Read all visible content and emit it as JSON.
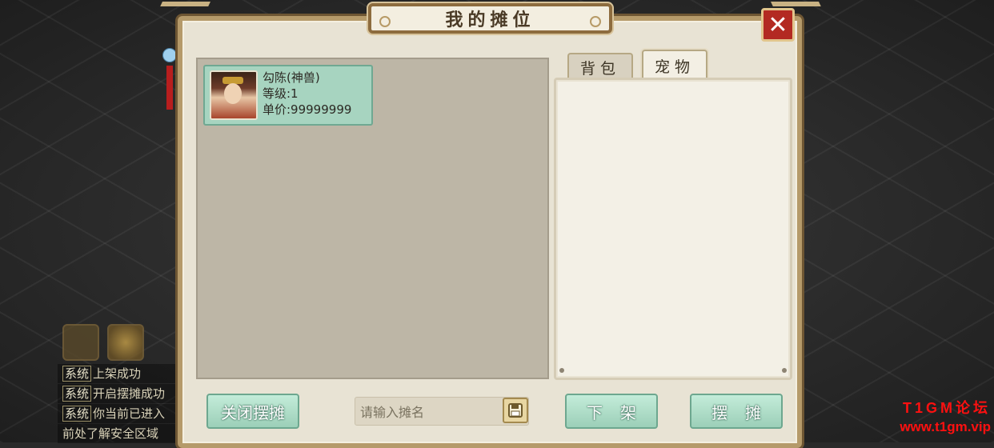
{
  "window": {
    "title": "我的摊位",
    "close_icon": "close-icon"
  },
  "chat_log": {
    "lines": [
      {
        "tag": "系统",
        "text": "上架成功"
      },
      {
        "tag": "系统",
        "text": "开启摆摊成功"
      },
      {
        "tag": "系统",
        "text": "你当前已进入"
      },
      {
        "tag": "",
        "text": "前处了解安全区域"
      }
    ]
  },
  "stall": {
    "items": [
      {
        "name": "勾陈(神兽)",
        "level": "等级:1",
        "price": "单价:99999999"
      }
    ]
  },
  "tabs": [
    {
      "label": "背包",
      "active": false
    },
    {
      "label": "宠物",
      "active": true
    }
  ],
  "controls": {
    "close_stall_label": "关闭摆摊",
    "stall_name_placeholder": "请输入摊名",
    "stall_name_value": "",
    "unlist_label": "下架",
    "set_stall_label": "摆摊"
  },
  "watermark": {
    "line1": "T1GM论坛",
    "line2": "www.t1gm.vip"
  },
  "colors": {
    "accent_green": "#9ccfb8",
    "close_red": "#b32a22",
    "frame_brown": "#8d6c3e"
  }
}
